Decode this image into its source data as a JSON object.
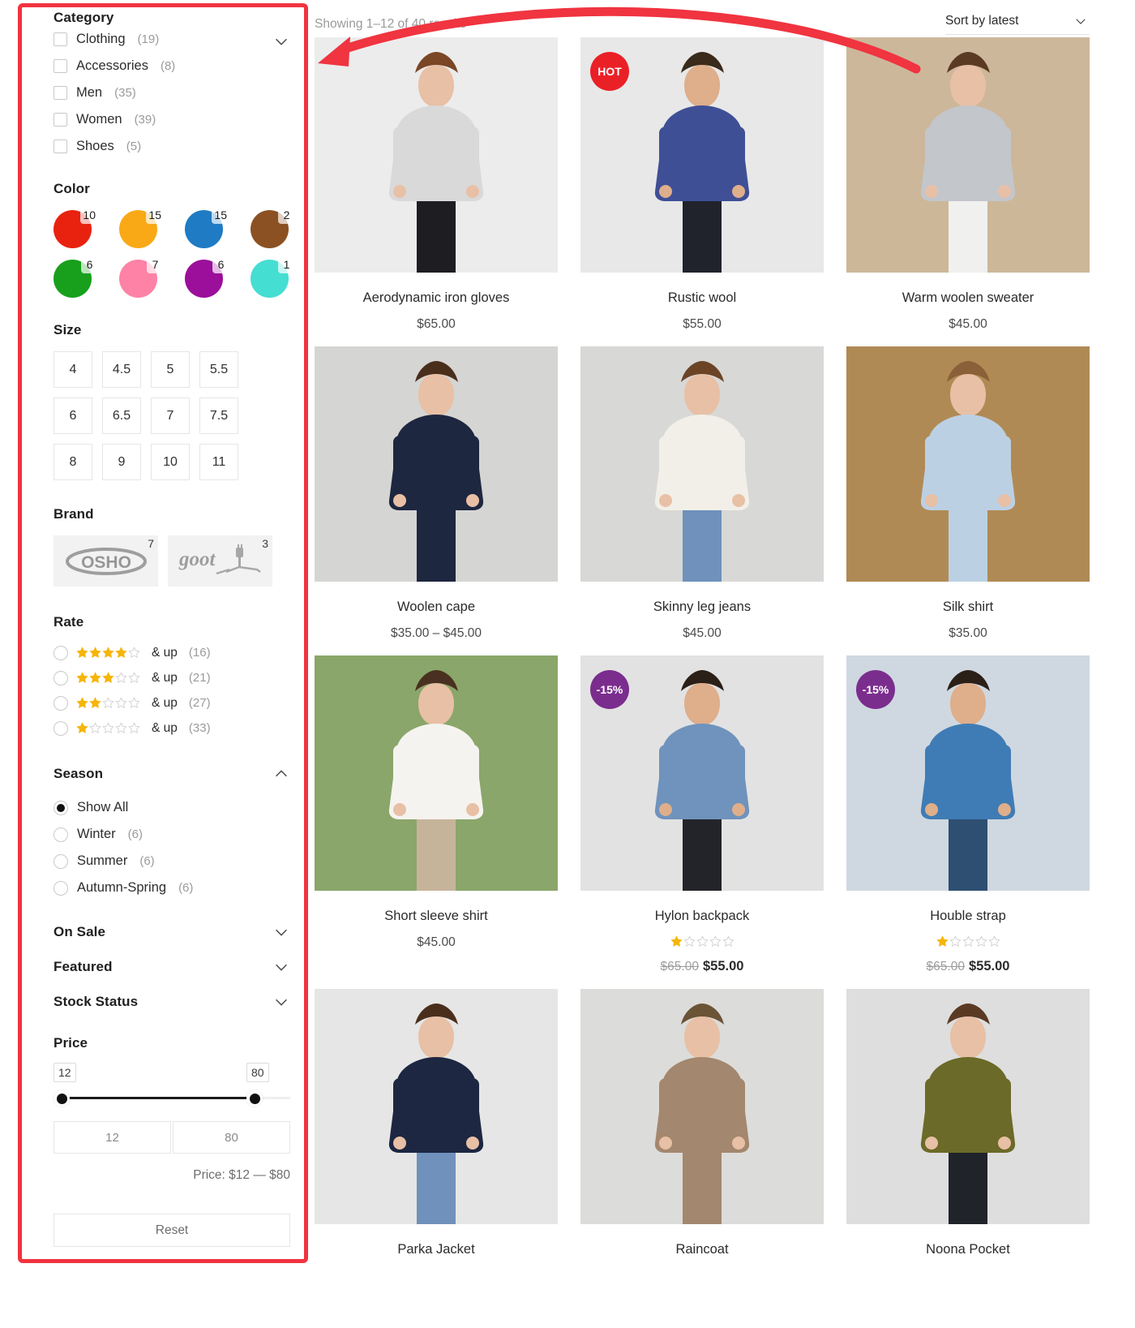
{
  "annotation": {
    "arrow_color": "#f03440",
    "highlight_color": "#f03440"
  },
  "sidebar": {
    "category": {
      "title": "Category",
      "chevron": "chevron-down-icon",
      "items": [
        {
          "label": "Clothing",
          "count": "(19)"
        },
        {
          "label": "Accessories",
          "count": "(8)"
        },
        {
          "label": "Men",
          "count": "(35)"
        },
        {
          "label": "Women",
          "count": "(39)"
        },
        {
          "label": "Shoes",
          "count": "(5)"
        }
      ]
    },
    "color": {
      "title": "Color",
      "swatches": [
        {
          "name": "red",
          "hex": "#e8220f",
          "count": "10"
        },
        {
          "name": "orange",
          "hex": "#f9a916",
          "count": "15"
        },
        {
          "name": "blue",
          "hex": "#1f7bc4",
          "count": "15"
        },
        {
          "name": "brown",
          "hex": "#8c5122",
          "count": "2"
        },
        {
          "name": "green",
          "hex": "#18a01c",
          "count": "6"
        },
        {
          "name": "pink",
          "hex": "#fd82a6",
          "count": "7"
        },
        {
          "name": "purple",
          "hex": "#9b0f9b",
          "count": "6"
        },
        {
          "name": "turquoise",
          "hex": "#45ded2",
          "count": "1"
        }
      ]
    },
    "size": {
      "title": "Size",
      "values": [
        "4",
        "4.5",
        "5",
        "5.5",
        "6",
        "6.5",
        "7",
        "7.5",
        "8",
        "9",
        "10",
        "11"
      ]
    },
    "brand": {
      "title": "Brand",
      "items": [
        {
          "name": "OSHO",
          "count": "7"
        },
        {
          "name": "goot",
          "count": "3"
        }
      ]
    },
    "rate": {
      "title": "Rate",
      "and_up": "& up",
      "items": [
        {
          "stars": 4,
          "count": "(16)"
        },
        {
          "stars": 3,
          "count": "(21)"
        },
        {
          "stars": 2,
          "count": "(27)"
        },
        {
          "stars": 1,
          "count": "(33)"
        }
      ]
    },
    "season": {
      "title": "Season",
      "chevron": "chevron-up-icon",
      "items": [
        {
          "label": "Show All",
          "count": "",
          "selected": true
        },
        {
          "label": "Winter",
          "count": "(6)",
          "selected": false
        },
        {
          "label": "Summer",
          "count": "(6)",
          "selected": false
        },
        {
          "label": "Autumn-Spring",
          "count": "(6)",
          "selected": false
        }
      ]
    },
    "collapsed_sections": [
      {
        "title": "On Sale",
        "chevron": "chevron-down-icon"
      },
      {
        "title": "Featured",
        "chevron": "chevron-down-icon"
      },
      {
        "title": "Stock Status",
        "chevron": "chevron-down-icon"
      }
    ],
    "price": {
      "title": "Price",
      "min_tip": "12",
      "max_tip": "80",
      "min_input": "12",
      "max_input": "80",
      "summary": "Price: $12 — $80"
    },
    "reset_label": "Reset"
  },
  "main": {
    "showing": "Showing 1–12 of 40 results",
    "sort": {
      "label": "Sort by latest",
      "chevron": "chevron-down-icon"
    },
    "products": [
      {
        "title": "Aerodynamic iron gloves",
        "price": "$65.00",
        "badge": null,
        "stars": 0,
        "old_price": null,
        "img": "woman-grey-tunic"
      },
      {
        "title": "Rustic wool",
        "price": "$55.00",
        "badge": {
          "text": "HOT",
          "color": "#ea2027"
        },
        "stars": 0,
        "old_price": null,
        "img": "man-blue-tshirt"
      },
      {
        "title": "Warm woolen sweater",
        "price": "$45.00",
        "badge": null,
        "stars": 0,
        "old_price": null,
        "img": "woman-grey-sweater"
      },
      {
        "title": "Woolen cape",
        "price": "$35.00 – $45.00",
        "badge": null,
        "stars": 0,
        "old_price": null,
        "img": "woman-navy-cape"
      },
      {
        "title": "Skinny leg jeans",
        "price": "$45.00",
        "badge": null,
        "stars": 0,
        "old_price": null,
        "img": "woman-jeans-street"
      },
      {
        "title": "Silk shirt",
        "price": "$35.00",
        "badge": null,
        "stars": 0,
        "old_price": null,
        "img": "woman-blue-coat"
      },
      {
        "title": "Short sleeve shirt",
        "price": "$45.00",
        "badge": null,
        "stars": 0,
        "old_price": null,
        "img": "woman-white-shirt-field"
      },
      {
        "title": "Hylon backpack",
        "price": "$55.00",
        "badge": {
          "text": "-15%",
          "color": "#7b2d8e"
        },
        "stars": 1,
        "old_price": "$65.00",
        "img": "man-denim-bag"
      },
      {
        "title": "Houble strap",
        "price": "$55.00",
        "badge": {
          "text": "-15%",
          "color": "#7b2d8e"
        },
        "stars": 1,
        "old_price": "$65.00",
        "img": "man-backpack"
      },
      {
        "title": "Parka Jacket",
        "price": "",
        "badge": null,
        "stars": 0,
        "old_price": null,
        "img": "woman-navy-parka"
      },
      {
        "title": "Raincoat",
        "price": "",
        "badge": null,
        "stars": 0,
        "old_price": null,
        "img": "woman-tan-raincoat"
      },
      {
        "title": "Noona Pocket",
        "price": "",
        "badge": null,
        "stars": 0,
        "old_price": null,
        "img": "woman-olive-anorak"
      }
    ]
  }
}
